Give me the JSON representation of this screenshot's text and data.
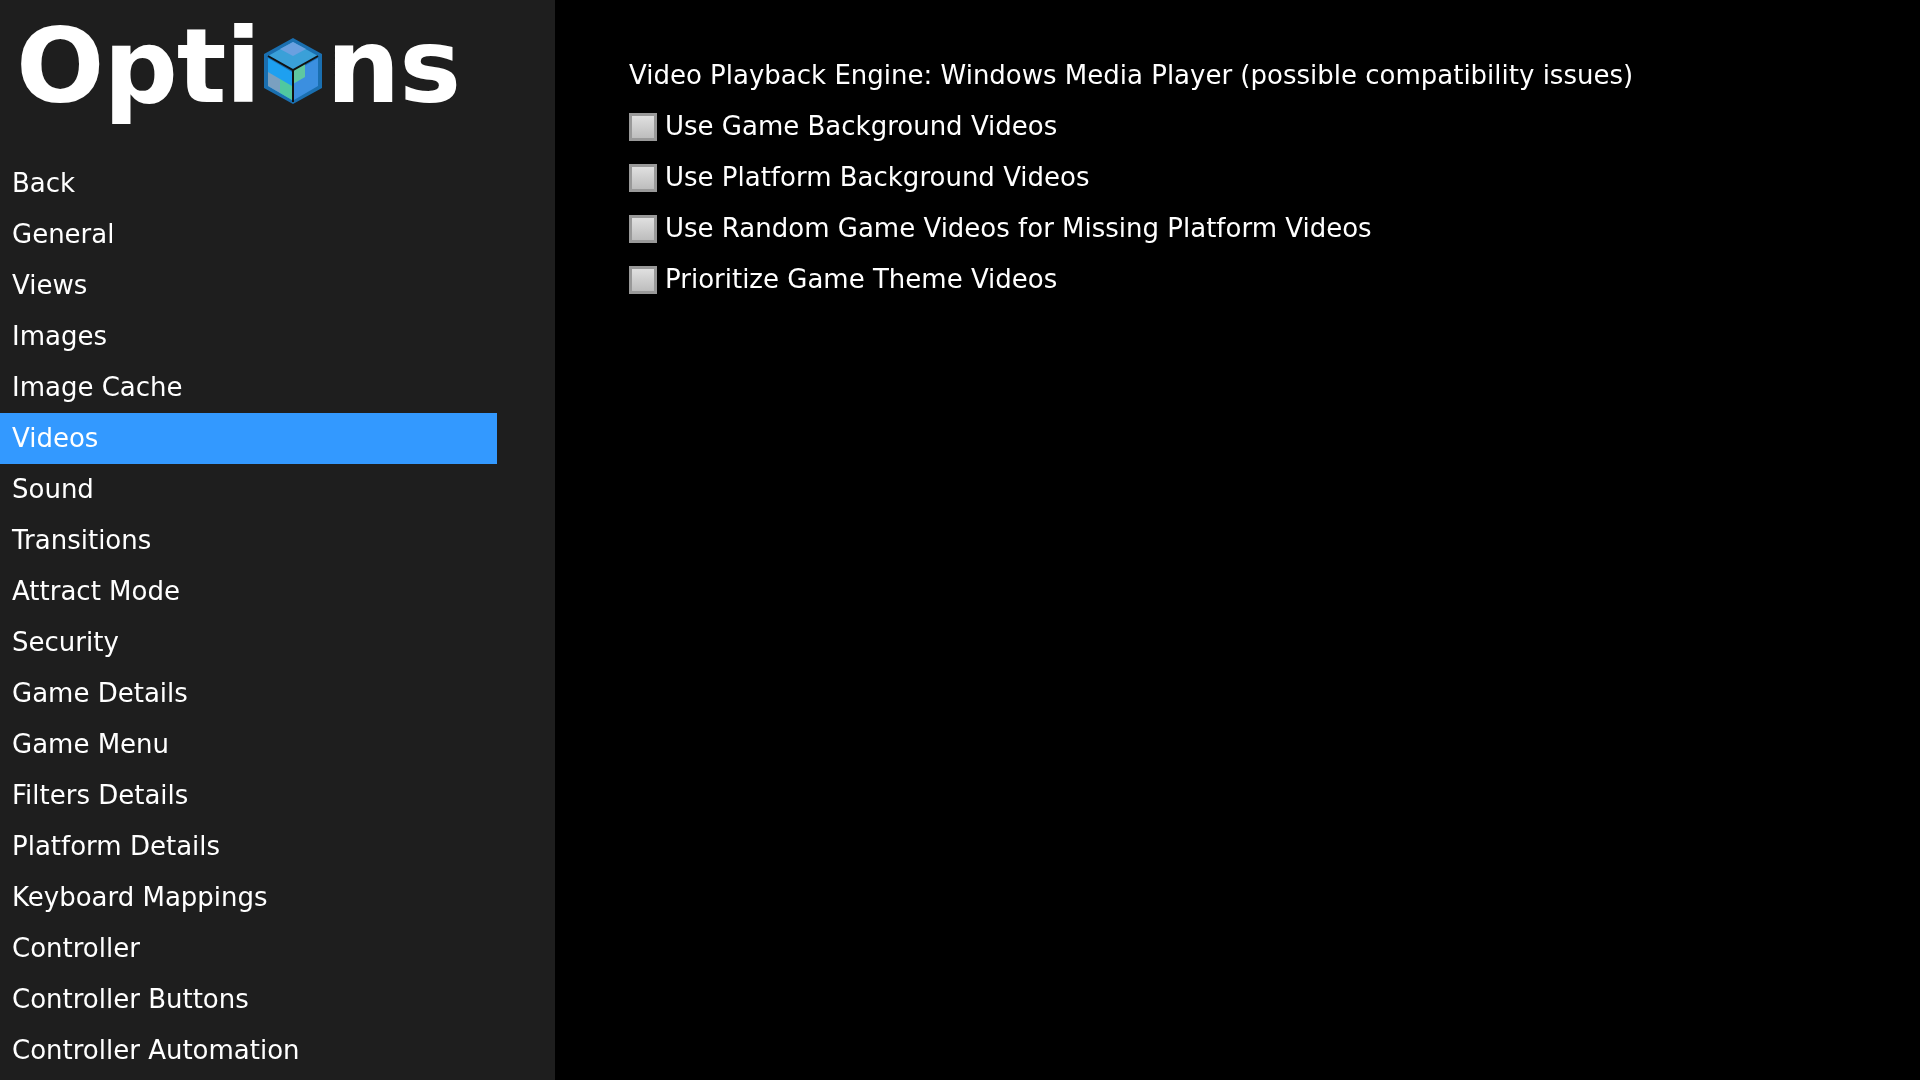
{
  "title": {
    "before": "Opti",
    "after": "ns"
  },
  "sidebar": {
    "items": [
      {
        "label": "Back",
        "selected": false
      },
      {
        "label": "General",
        "selected": false
      },
      {
        "label": "Views",
        "selected": false
      },
      {
        "label": "Images",
        "selected": false
      },
      {
        "label": "Image Cache",
        "selected": false
      },
      {
        "label": "Videos",
        "selected": true
      },
      {
        "label": "Sound",
        "selected": false
      },
      {
        "label": "Transitions",
        "selected": false
      },
      {
        "label": "Attract Mode",
        "selected": false
      },
      {
        "label": "Security",
        "selected": false
      },
      {
        "label": "Game Details",
        "selected": false
      },
      {
        "label": "Game Menu",
        "selected": false
      },
      {
        "label": "Filters Details",
        "selected": false
      },
      {
        "label": "Platform Details",
        "selected": false
      },
      {
        "label": "Keyboard Mappings",
        "selected": false
      },
      {
        "label": "Controller",
        "selected": false
      },
      {
        "label": "Controller Buttons",
        "selected": false
      },
      {
        "label": "Controller Automation",
        "selected": false
      }
    ]
  },
  "content": {
    "engine": "Video Playback Engine: Windows Media Player (possible compatibility issues)",
    "options": [
      {
        "label": "Use Game Background Videos",
        "checked": false
      },
      {
        "label": "Use Platform Background Videos",
        "checked": false
      },
      {
        "label": "Use Random Game Videos for Missing Platform Videos",
        "checked": false
      },
      {
        "label": "Prioritize Game Theme Videos",
        "checked": false
      }
    ]
  }
}
